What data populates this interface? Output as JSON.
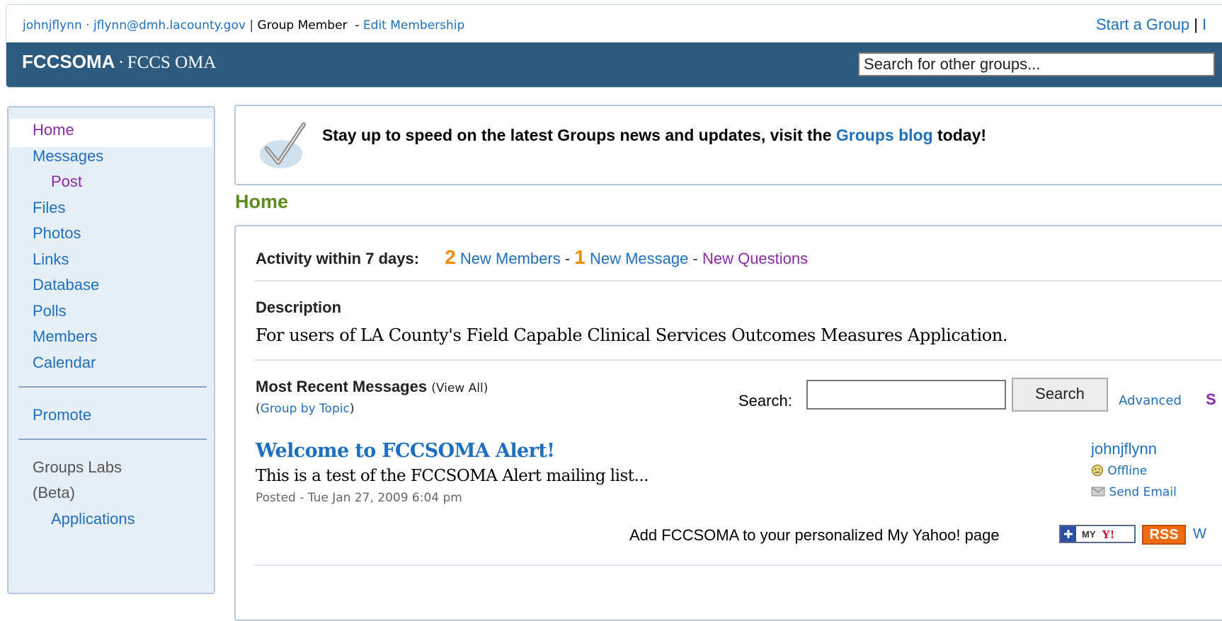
{
  "user": {
    "name": "johnjflynn",
    "separator": "·",
    "email": "jflynn@dmh.lacounty.gov",
    "pipe": "|",
    "role": "Group Member",
    "dash": "-",
    "edit_link": "Edit Membership"
  },
  "top_right": {
    "start_group": "Start a Group",
    "pipe": "|",
    "cut": "I"
  },
  "group": {
    "short_name": "FCCSOMA",
    "separator": "·",
    "long_name": "FCCS OMA"
  },
  "group_search": {
    "value": "Search for other groups..."
  },
  "sidebar": {
    "items": [
      {
        "label": "Home"
      },
      {
        "label": "Messages"
      },
      {
        "label": "Post"
      },
      {
        "label": "Files"
      },
      {
        "label": "Photos"
      },
      {
        "label": "Links"
      },
      {
        "label": "Database"
      },
      {
        "label": "Polls"
      },
      {
        "label": "Members"
      },
      {
        "label": "Calendar"
      }
    ],
    "promote": "Promote",
    "labs_line1": "Groups Labs",
    "labs_line2": "(Beta)",
    "applications": "Applications"
  },
  "announcement": {
    "text_before": "Stay up to speed on the latest Groups news and updates, visit the ",
    "link": "Groups blog",
    "text_after": " today!"
  },
  "page_title": "Home",
  "activity": {
    "label": "Activity within 7 days:",
    "new_members_count": "2",
    "new_members_label": "New Members",
    "dash": "-",
    "new_message_count": "1",
    "new_message_label": "New Message",
    "new_questions_label": "New Questions"
  },
  "description": {
    "heading": "Description",
    "text": "For users of LA County's Field Capable Clinical Services Outcomes Measures Application."
  },
  "recent_messages": {
    "heading": "Most Recent Messages",
    "view_all_open": "(",
    "view_all": "View All",
    "view_all_close": ")",
    "group_by_open": "(",
    "group_by": "Group by Topic",
    "group_by_close": ")",
    "search_label": "Search:",
    "search_value": "",
    "search_button": "Search",
    "advanced": "Advanced",
    "cut_letter": "S"
  },
  "post": {
    "title": "Welcome to FCCSOMA Alert!",
    "snippet": "This is a test of the FCCSOMA Alert mailing list...",
    "meta": "Posted - Tue Jan 27, 2009 6:04 pm",
    "author": "johnjflynn",
    "status": "Offline",
    "send_email": "Send Email"
  },
  "add_to_yahoo": {
    "text": "Add FCCSOMA to your personalized My Yahoo! page",
    "myyahoo_label": "MY Y!",
    "rss_label": "RSS",
    "cut": "W"
  },
  "colors": {
    "banner": "#2d5a7f",
    "link": "#1f6fc0",
    "visited": "#8a2aa8",
    "count": "#f08c00",
    "page_title": "#5f8a1d",
    "sidebar_bg": "#e6eef6"
  }
}
